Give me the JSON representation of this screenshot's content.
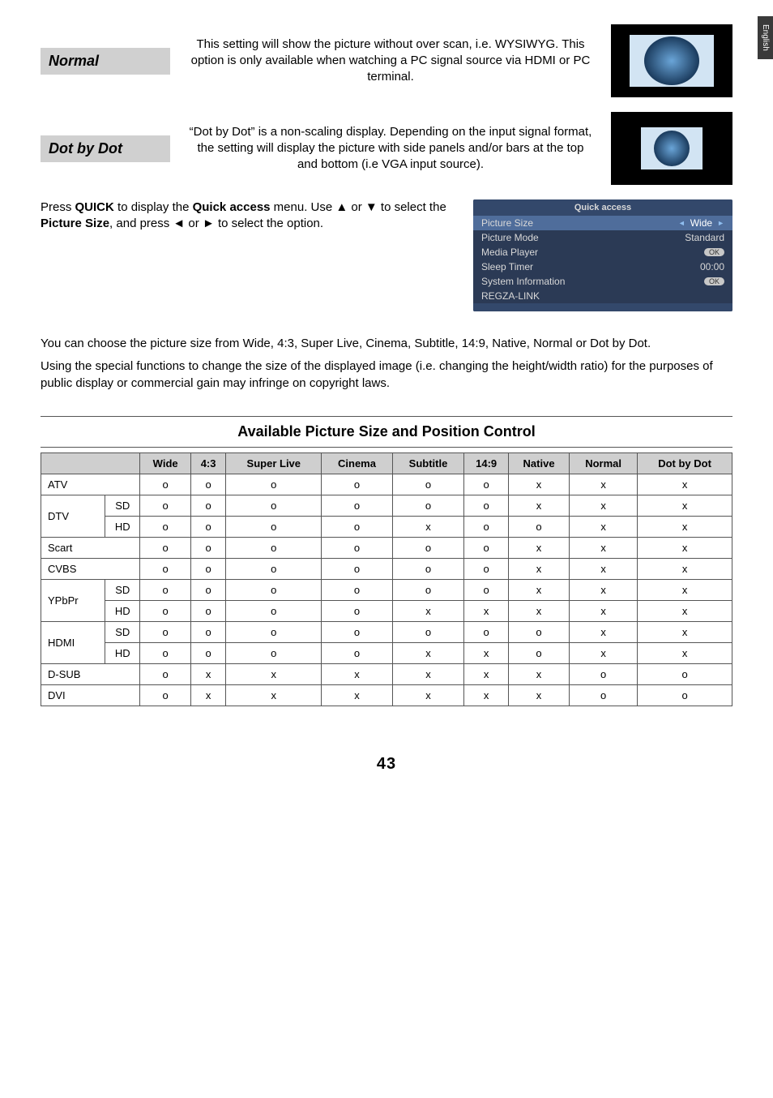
{
  "lang_tab": "English",
  "modes": {
    "normal": {
      "label": "Normal",
      "desc": "This setting will show the picture without over scan, i.e. WYSIWYG. This option is only available when watching a PC signal source via HDMI or PC terminal."
    },
    "dotbydot": {
      "label": "Dot by Dot",
      "desc": "“Dot by Dot” is a non-scaling display. Depending on the input signal format, the setting will display the picture with side panels and/or bars at the top and bottom (i.e VGA input source)."
    }
  },
  "quick_instr_html": "Press <b>QUICK</b> to display the <b>Quick access</b> menu. Use ▲ or ▼ to select the <b>Picture Size</b>, and press ◄ or ► to select the option.",
  "quick_panel": {
    "title": "Quick access",
    "items": [
      {
        "label": "Picture Size",
        "value": "Wide",
        "selected": true,
        "arrows": true
      },
      {
        "label": "Picture Mode",
        "value": "Standard"
      },
      {
        "label": "Media Player",
        "value_ok": true
      },
      {
        "label": "Sleep Timer",
        "value": "00:00"
      },
      {
        "label": "System Information",
        "value_ok": true
      },
      {
        "label": "REGZA-LINK",
        "value": ""
      }
    ]
  },
  "para1": "You can choose the picture size from Wide, 4:3, Super Live, Cinema, Subtitle, 14:9, Native, Normal or Dot by Dot.",
  "para2": "Using the special functions to change the size of the displayed image (i.e. changing the height/width ratio) for the purposes of public display or commercial gain may infringe on copyright laws.",
  "section_title": "Available Picture Size and Position Control",
  "table": {
    "headers": [
      "Wide",
      "4:3",
      "Super Live",
      "Cinema",
      "Subtitle",
      "14:9",
      "Native",
      "Normal",
      "Dot by Dot"
    ],
    "rows": [
      {
        "name": "ATV",
        "cells": [
          "o",
          "o",
          "o",
          "o",
          "o",
          "o",
          "x",
          "x",
          "x"
        ]
      },
      {
        "name": "DTV",
        "sub": "SD",
        "cells": [
          "o",
          "o",
          "o",
          "o",
          "o",
          "o",
          "x",
          "x",
          "x"
        ],
        "rowspan_start": true
      },
      {
        "sub": "HD",
        "cells": [
          "o",
          "o",
          "o",
          "o",
          "x",
          "o",
          "o",
          "x",
          "x"
        ]
      },
      {
        "name": "Scart",
        "cells": [
          "o",
          "o",
          "o",
          "o",
          "o",
          "o",
          "x",
          "x",
          "x"
        ]
      },
      {
        "name": "CVBS",
        "cells": [
          "o",
          "o",
          "o",
          "o",
          "o",
          "o",
          "x",
          "x",
          "x"
        ]
      },
      {
        "name": "YPbPr",
        "sub": "SD",
        "cells": [
          "o",
          "o",
          "o",
          "o",
          "o",
          "o",
          "x",
          "x",
          "x"
        ],
        "rowspan_start": true
      },
      {
        "sub": "HD",
        "cells": [
          "o",
          "o",
          "o",
          "o",
          "x",
          "x",
          "x",
          "x",
          "x"
        ]
      },
      {
        "name": "HDMI",
        "sub": "SD",
        "cells": [
          "o",
          "o",
          "o",
          "o",
          "o",
          "o",
          "o",
          "x",
          "x"
        ],
        "rowspan_start": true
      },
      {
        "sub": "HD",
        "cells": [
          "o",
          "o",
          "o",
          "o",
          "x",
          "x",
          "o",
          "x",
          "x"
        ]
      },
      {
        "name": "D-SUB",
        "cells": [
          "o",
          "x",
          "x",
          "x",
          "x",
          "x",
          "x",
          "o",
          "o"
        ]
      },
      {
        "name": "DVI",
        "cells": [
          "o",
          "x",
          "x",
          "x",
          "x",
          "x",
          "x",
          "o",
          "o"
        ]
      }
    ]
  },
  "page_number": "43"
}
